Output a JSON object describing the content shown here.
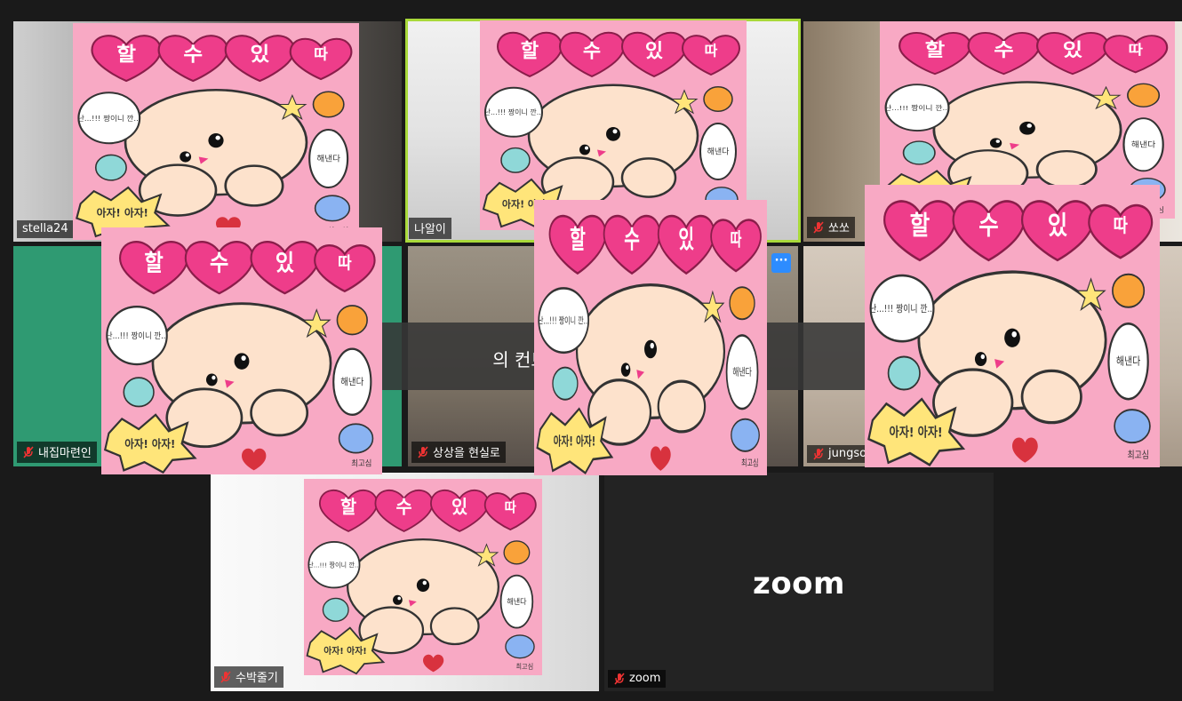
{
  "participants": [
    {
      "name": "stella24",
      "muted": false
    },
    {
      "name": "나알이",
      "muted": false,
      "active_speaker": true
    },
    {
      "name": "쏘쏘",
      "muted": true
    },
    {
      "name": "내집마련인",
      "muted": true
    },
    {
      "name": "상상을 현실로",
      "muted": true
    },
    {
      "name": "jungso",
      "muted": true
    },
    {
      "name": "수박줄기",
      "muted": true
    },
    {
      "name": "zoom",
      "muted": true
    }
  ],
  "zoom_logo": "zoom",
  "hint_banner": "의 컨트롤을 표시  누릅니다",
  "more_button": "···",
  "sticker": {
    "heart1": "할",
    "heart2": "수",
    "heart3": "있",
    "heart4": "따",
    "bubble_left": "난...!!! 짱이니 깐...",
    "bubble_right": "해낸다",
    "burst": "아자! 아자!",
    "signature": "최고심"
  },
  "colors": {
    "active_border": "#a9d93a",
    "more_button": "#2d8cff",
    "sticker_bg": "#f8a9c4",
    "heart": "#ee3d8a",
    "dog": "#fde2cc"
  }
}
